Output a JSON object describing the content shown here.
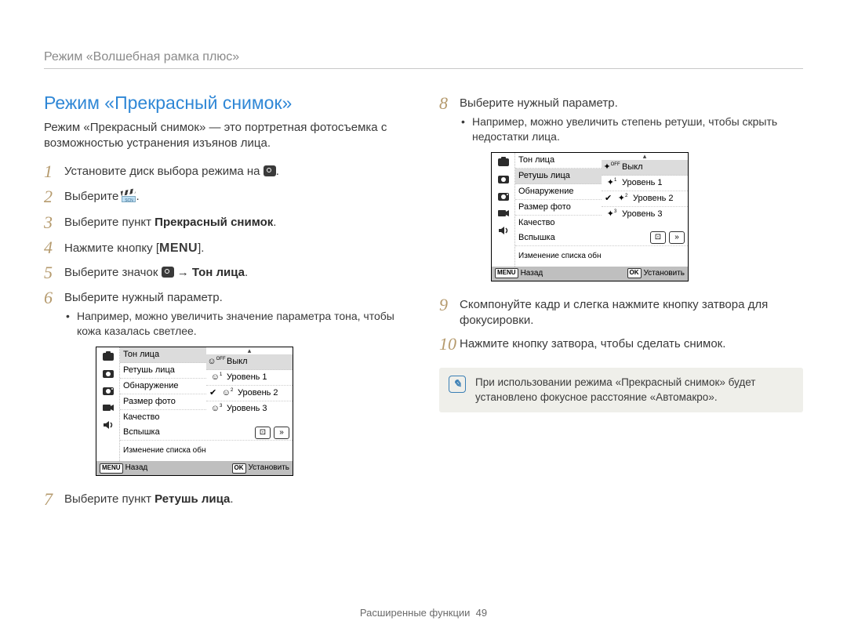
{
  "header": {
    "breadcrumb": "Режим «Волшебная рамка плюс»"
  },
  "section_title": "Режим «Прекрасный снимок»",
  "intro": "Режим «Прекрасный снимок» — это портретная фотосъемка с возможностью устранения изъянов лица.",
  "steps": {
    "s1": {
      "num": "1",
      "text_before": "Установите диск выбора режима на ",
      "text_after": "."
    },
    "s2": {
      "num": "2",
      "text": "Выберите ",
      "clapper_label": "SCN",
      "text_after": "."
    },
    "s3": {
      "num": "3",
      "text_before": "Выберите пункт ",
      "bold": "Прекрасный снимок",
      "text_after": "."
    },
    "s4": {
      "num": "4",
      "text_before": "Нажмите кнопку [",
      "menu_word": "MENU",
      "text_after": "]."
    },
    "s5": {
      "num": "5",
      "text_before": "Выберите значок ",
      "arrow_bold": " → Тон лица",
      "text_after": "."
    },
    "s6": {
      "num": "6",
      "text": "Выберите нужный параметр.",
      "bullet": "Например, можно увеличить значение параметра тона, чтобы кожа казалась светлее."
    },
    "s7": {
      "num": "7",
      "text_before": "Выберите пункт ",
      "bold": "Ретушь лица",
      "text_after": "."
    },
    "s8": {
      "num": "8",
      "text": "Выберите нужный параметр.",
      "bullet": "Например, можно увеличить степень ретуши, чтобы скрыть недостатки лица."
    },
    "s9": {
      "num": "9",
      "text": "Скомпонуйте кадр и слегка нажмите кнопку затвора для фокусировки."
    },
    "s10": {
      "num": "10",
      "text": "Нажмите кнопку затвора, чтобы сделать снимок."
    }
  },
  "ui_menu": {
    "side_icons": [
      "camera-mode-icon",
      "camera-icon",
      "camera-alt-icon",
      "video-icon",
      "sound-icon"
    ],
    "items": [
      "Тон лица",
      "Ретушь лица",
      "Обнаружение",
      "Размер фото",
      "Качество",
      "Вспышка",
      "Изменение списка обнаруживаемых лиц"
    ],
    "options_a": {
      "highlight_row": "Тон лица",
      "rows": [
        {
          "icon": "face-off-icon",
          "sub": "OFF",
          "label": "Выкл"
        },
        {
          "icon": "face-level-icon",
          "sub": "1",
          "label": "Уровень 1"
        },
        {
          "icon": "face-level-icon",
          "sub": "2",
          "label": "Уровень 2",
          "checked": true
        },
        {
          "icon": "face-level-icon",
          "sub": "3",
          "label": "Уровень 3"
        }
      ]
    },
    "options_b": {
      "highlight_row": "Ретушь лица",
      "rows": [
        {
          "icon": "sparkle-off-icon",
          "sub": "OFF",
          "label": "Выкл"
        },
        {
          "icon": "sparkle-level-icon",
          "sub": "1",
          "label": "Уровень 1"
        },
        {
          "icon": "sparkle-level-icon",
          "sub": "2",
          "label": "Уровень 2",
          "checked": true
        },
        {
          "icon": "sparkle-level-icon",
          "sub": "3",
          "label": "Уровень 3"
        }
      ]
    },
    "nav": {
      "left_icon": "frame-icon",
      "right_icon": "double-chevron-right-icon"
    },
    "footer": {
      "left_chip": "MENU",
      "left_label": "Назад",
      "right_chip": "OK",
      "right_label": "Установить"
    }
  },
  "note": "При использовании режима «Прекрасный снимок» будет установлено фокусное расстояние «Автомакро».",
  "footer": {
    "label": "Расширенные функции",
    "page_no": "49"
  }
}
